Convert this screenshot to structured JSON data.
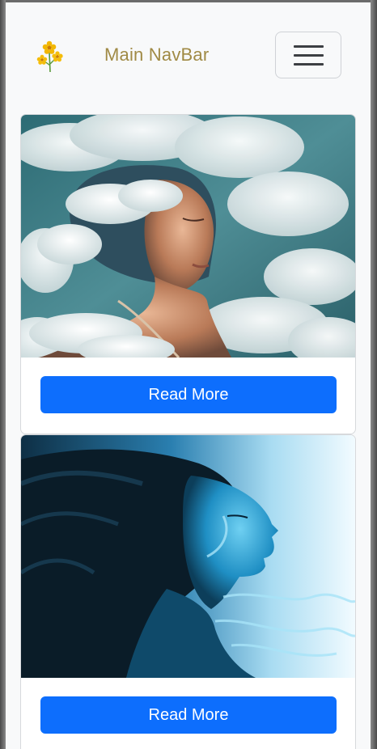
{
  "navbar": {
    "brand_text": "Main NavBar",
    "logo_icon": "flower-icon",
    "toggler_icon": "hamburger-menu-icon"
  },
  "colors": {
    "brand_text": "#a08a45",
    "primary_button": "#0d6efd",
    "navbar_bg": "#f8f9fa"
  },
  "cards": [
    {
      "image_subject": "woman-with-clouds",
      "button_label": "Read More"
    },
    {
      "image_subject": "woman-blue-smoke",
      "button_label": "Read More"
    }
  ]
}
